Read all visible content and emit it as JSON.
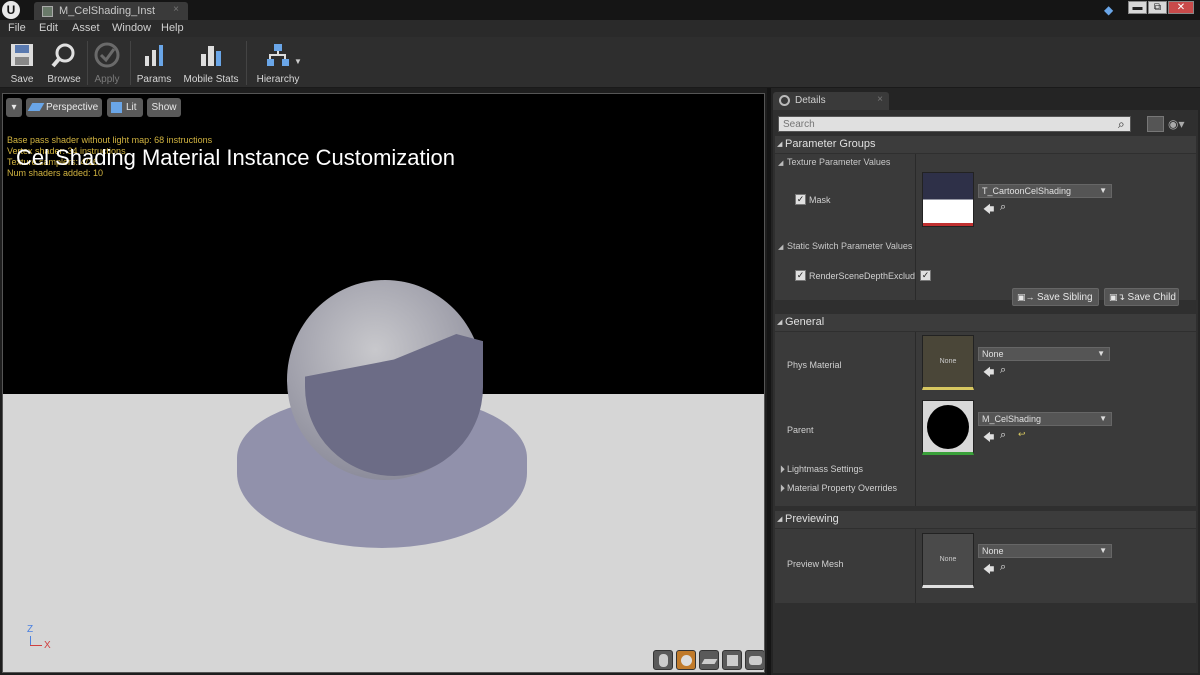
{
  "window": {
    "logo": "U",
    "tab_label": "M_CelShading_Inst",
    "tab_close": "×",
    "minimize": "▬",
    "restore": "⧉",
    "close": "✕"
  },
  "menu": [
    "File",
    "Edit",
    "Asset",
    "Window",
    "Help"
  ],
  "toolbar": {
    "save": "Save",
    "browse": "Browse",
    "apply": "Apply",
    "params": "Params",
    "mobile_stats": "Mobile Stats",
    "hierarchy": "Hierarchy"
  },
  "viewport": {
    "dropdown": "▾",
    "perspective": "Perspective",
    "lit": "Lit",
    "show": "Show",
    "stats": [
      "Base pass shader without light map: 68 instructions",
      "Vertex shader: 34 instructions",
      "Texture samplers: 4/16",
      "Num shaders added: 10"
    ],
    "headline": "Cel Shading Material Instance Customization",
    "axis_z": "Z",
    "axis_x": "X"
  },
  "details": {
    "tab_label": "Details",
    "tab_close": "×",
    "search_placeholder": "Search",
    "parameter_groups": {
      "title": "Parameter Groups",
      "texture_header": "Texture Parameter Values",
      "mask_label": "Mask",
      "mask_value": "T_CartoonCelShading",
      "switch_header": "Static Switch Parameter Values",
      "switch_label": "RenderSceneDepthExclude",
      "save_sibling": "Save Sibling",
      "save_child": "Save Child"
    },
    "general": {
      "title": "General",
      "phys_label": "Phys Material",
      "phys_value": "None",
      "phys_thumb": "None",
      "parent_label": "Parent",
      "parent_value": "M_CelShading",
      "lightmass": "Lightmass Settings",
      "overrides": "Material Property Overrides"
    },
    "previewing": {
      "title": "Previewing",
      "mesh_label": "Preview Mesh",
      "mesh_value": "None",
      "mesh_thumb": "None"
    }
  },
  "colors": {
    "stats_text": "#d2b440",
    "accent_green": "#3aa03a",
    "accent_yellow": "#d8c860",
    "accent_red": "#c03030"
  }
}
